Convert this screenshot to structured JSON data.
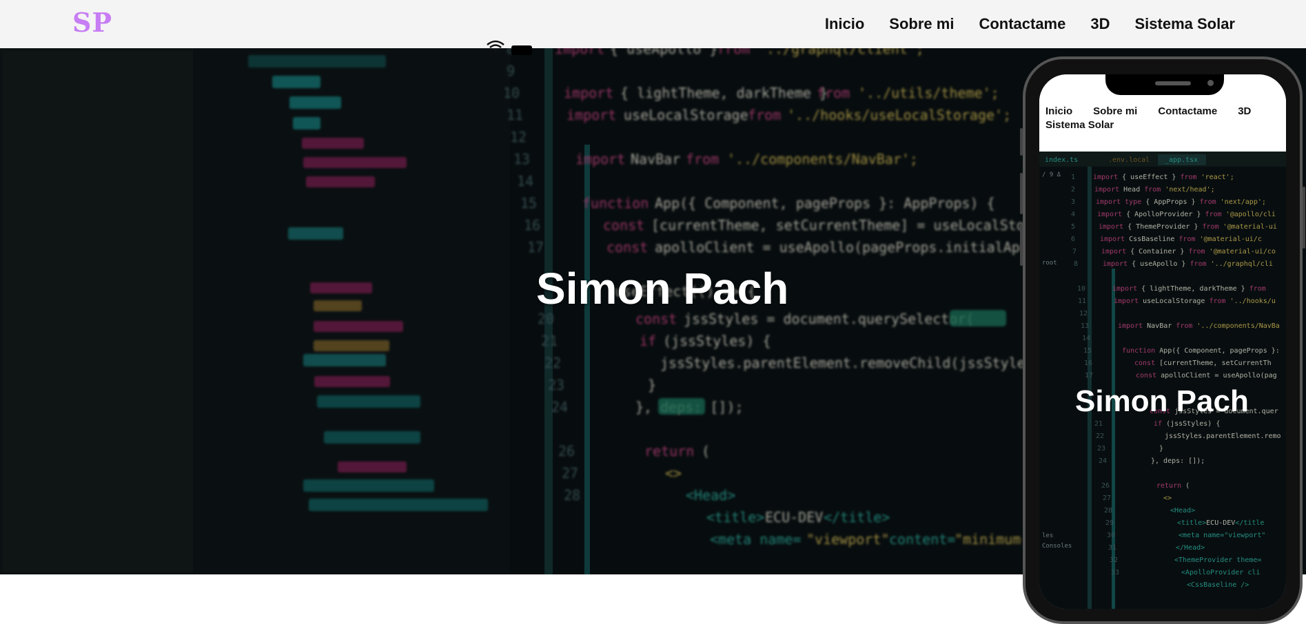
{
  "header": {
    "logo": "SP",
    "nav": [
      "Inicio",
      "Sobre mi",
      "Contactame",
      "3D",
      "Sistema Solar"
    ]
  },
  "hero": {
    "title": "Simon Pach"
  },
  "mobile": {
    "nav": [
      "Inicio",
      "Sobre mi",
      "Contactame",
      "3D",
      "Sistema Solar"
    ],
    "title": "Simon Pach"
  },
  "colors": {
    "logo": "#c77df3",
    "header_bg": "#f4f4f4",
    "hero_bg": "#0d1417"
  }
}
